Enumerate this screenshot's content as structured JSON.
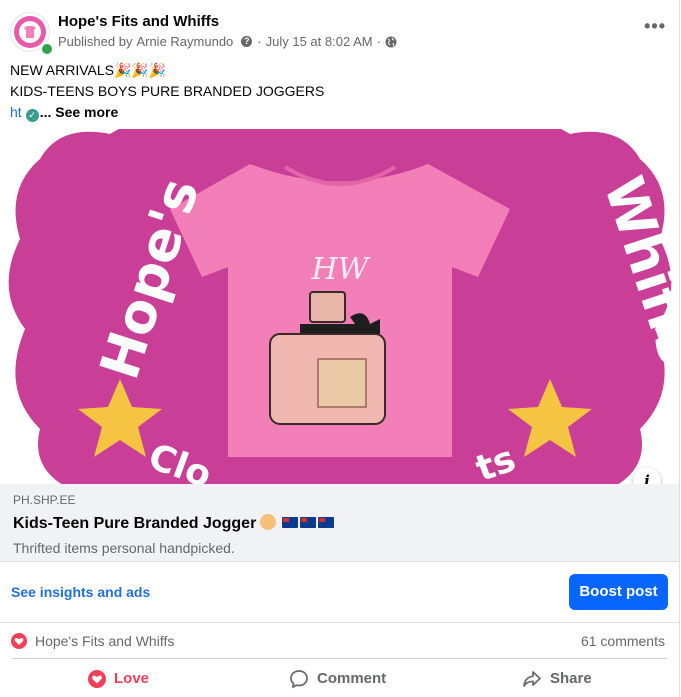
{
  "post": {
    "page_name": "Hope's Fits and Whiffs",
    "published_by_label": "Published by",
    "author": "Arnie Raymundo",
    "timestamp": "July 15 at 8:02 AM",
    "separator": "·",
    "text_line1": "NEW ARRIVALS🎉🎉🎉",
    "text_line2": "KIDS-TEENS BOYS PURE BRANDED JOGGERS",
    "text_link": "ht",
    "see_more": "... See more",
    "icons": {
      "avatar": "hope-logo-avatar",
      "online": "online-status-dot",
      "audience": "globe-icon",
      "more": "more-options-icon",
      "verified": "check-icon",
      "info": "info-icon"
    }
  },
  "image": {
    "logo_text_left": "Hope's",
    "logo_text_right": "Whiffs",
    "logo_text_bottom_left": "Clo",
    "logo_text_bottom_right": "ts",
    "shirt_monogram": "HW",
    "colors": {
      "background": "#c93f97",
      "shirt": "#f37fb9",
      "stars": "#f5c442",
      "text": "#ffffff"
    }
  },
  "link_preview": {
    "domain": "PH.SHP.EE",
    "title": "Kids-Teen Pure Branded Jogger",
    "description": "Thrifted items personal handpicked."
  },
  "insights": {
    "link_label": "See insights and ads",
    "boost_label": "Boost post"
  },
  "reactions": {
    "reactor": "Hope's Fits and Whiffs",
    "comments": "61 comments"
  },
  "actions": {
    "love": "Love",
    "comment": "Comment",
    "share": "Share"
  },
  "colors": {
    "brand_blue": "#0866ff",
    "link_blue": "#216fdb",
    "love_red": "#f33e58",
    "muted": "#65676b"
  }
}
